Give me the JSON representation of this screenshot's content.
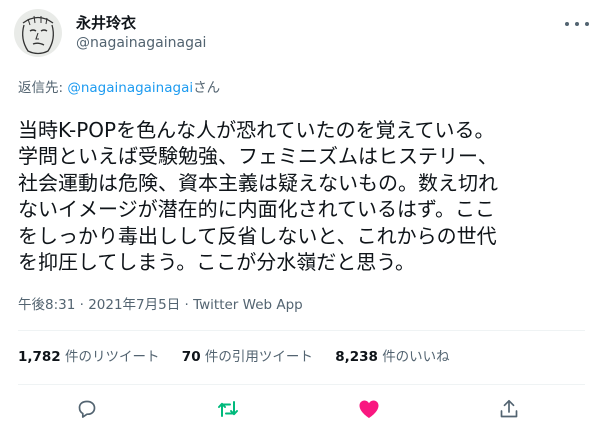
{
  "author": {
    "name": "永井玲衣",
    "handle": "@nagainagainagai"
  },
  "reply": {
    "prefix": "返信先: ",
    "target": "@nagainagainagai",
    "suffix": "さん"
  },
  "tweet": {
    "lines": [
      "当時K-POPを色んな人が恐れていたのを覚えている。",
      "学問といえば受験勉強、フェミニズムはヒステリー、",
      "社会運動は危険、資本主義は疑えないもの。数え切れ",
      "ないイメージが潜在的に内面化されているはず。ここ",
      "をしっかり毒出しして反省しないと、これからの世代",
      "を抑圧してしまう。ここが分水嶺だと思う。"
    ]
  },
  "meta": {
    "timestamp": "午後8:31 · 2021年7月5日 · Twitter Web App"
  },
  "stats": {
    "retweets": {
      "count": "1,782",
      "label": "件のリツイート"
    },
    "quotes": {
      "count": "70",
      "label": "件の引用ツイート"
    },
    "likes": {
      "count": "8,238",
      "label": "件のいいね"
    }
  },
  "colors": {
    "accent": "#1d9bf0",
    "retweet": "#00ba7c",
    "like": "#f91880",
    "muted": "#536471"
  },
  "icons": {
    "reply": "reply-icon",
    "retweet": "retweet-icon",
    "like": "heart-icon",
    "share": "share-icon",
    "more": "more-icon"
  }
}
